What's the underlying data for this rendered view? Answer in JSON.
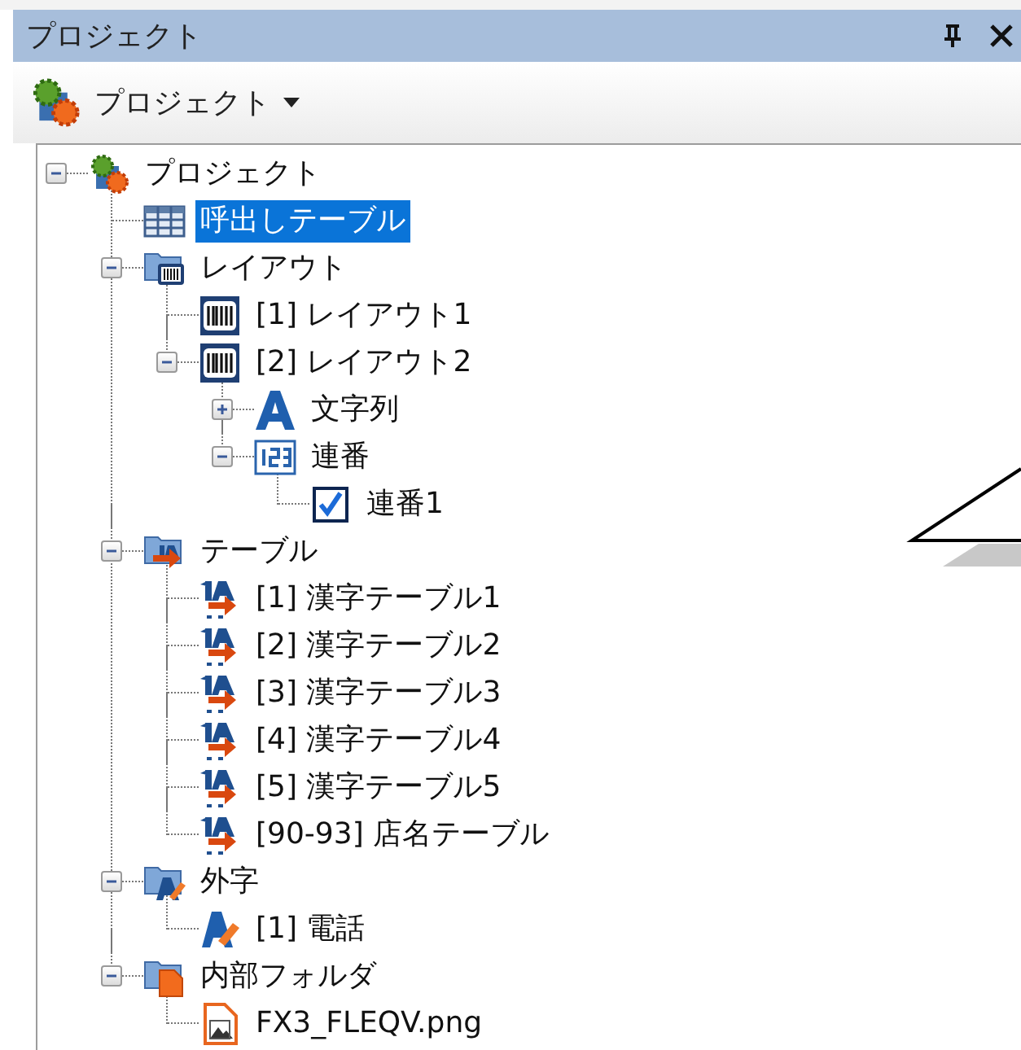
{
  "title_bar": {
    "title": "プロジェクト"
  },
  "toolbar": {
    "label": "プロジェクト"
  },
  "tree": [
    {
      "label": "プロジェクト",
      "kind": "project",
      "expanded": true,
      "selected": false,
      "children": [
        {
          "label": "呼出しテーブル",
          "kind": "grid",
          "selected": true
        },
        {
          "label": "レイアウト",
          "kind": "layout-folder",
          "expanded": true,
          "selected": false,
          "children": [
            {
              "label": "[1] レイアウト1",
              "kind": "layout",
              "selected": false
            },
            {
              "label": "[2] レイアウト2",
              "kind": "layout",
              "expanded": true,
              "selected": false,
              "children": [
                {
                  "label": "文字列",
                  "kind": "text",
                  "expanded": false,
                  "selected": false
                },
                {
                  "label": "連番",
                  "kind": "number",
                  "expanded": true,
                  "selected": false,
                  "children": [
                    {
                      "label": "連番1",
                      "kind": "checkbox",
                      "checked": true,
                      "selected": false
                    }
                  ]
                }
              ]
            }
          ]
        },
        {
          "label": "テーブル",
          "kind": "table-folder",
          "expanded": true,
          "selected": false,
          "children": [
            {
              "label": "[1] 漢字テーブル1",
              "kind": "kanji-table",
              "selected": false
            },
            {
              "label": "[2] 漢字テーブル2",
              "kind": "kanji-table",
              "selected": false
            },
            {
              "label": "[3] 漢字テーブル3",
              "kind": "kanji-table",
              "selected": false
            },
            {
              "label": "[4] 漢字テーブル4",
              "kind": "kanji-table",
              "selected": false
            },
            {
              "label": "[5] 漢字テーブル5",
              "kind": "kanji-table",
              "selected": false
            },
            {
              "label": "[90-93] 店名テーブル",
              "kind": "kanji-table",
              "selected": false
            }
          ]
        },
        {
          "label": "外字",
          "kind": "gaiji-folder",
          "expanded": true,
          "selected": false,
          "children": [
            {
              "label": "[1] 電話",
              "kind": "gaiji",
              "selected": false
            }
          ]
        },
        {
          "label": "内部フォルダ",
          "kind": "inner-folder",
          "expanded": true,
          "selected": false,
          "children": [
            {
              "label": "FX3_FLEQV.png",
              "kind": "image-file",
              "selected": false
            }
          ]
        }
      ]
    }
  ]
}
